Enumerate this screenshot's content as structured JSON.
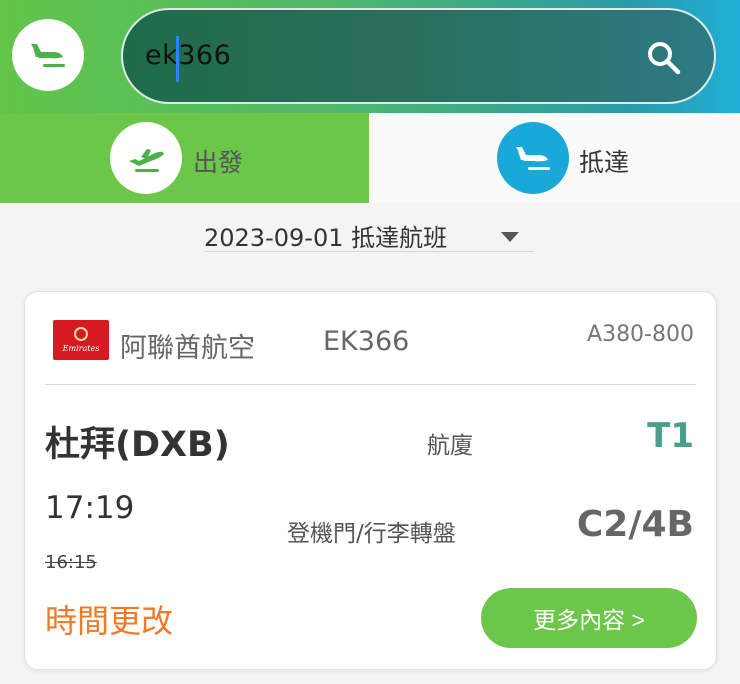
{
  "header": {
    "logo_icon": "plane-landing-icon",
    "search": {
      "value": "ek366",
      "icon": "search-icon"
    }
  },
  "tabs": [
    {
      "label": "出發",
      "icon": "plane-departure-icon",
      "active": false
    },
    {
      "label": "抵達",
      "icon": "plane-arrival-icon",
      "active": true
    }
  ],
  "date_selector": {
    "value": "2023-09-01  抵達航班",
    "icon": "dropdown-arrow-icon"
  },
  "flight": {
    "airline_logo_text": "Emirates",
    "airline": "阿聯酋航空",
    "flight_no": "EK366",
    "aircraft": "A380-800",
    "origin": "杜拜(DXB)",
    "terminal_label": "航廈",
    "terminal": "T1",
    "time_new": "17:19",
    "time_old": "16:15",
    "gate_label": "登機門/行李轉盤",
    "gate": "C2/4B",
    "status": "時間更改",
    "more_label": "更多內容 >"
  },
  "colors": {
    "green": "#6cc64a",
    "blue": "#18a9d8",
    "teal_value": "#4a9e8c",
    "status_orange": "#f07a25"
  }
}
